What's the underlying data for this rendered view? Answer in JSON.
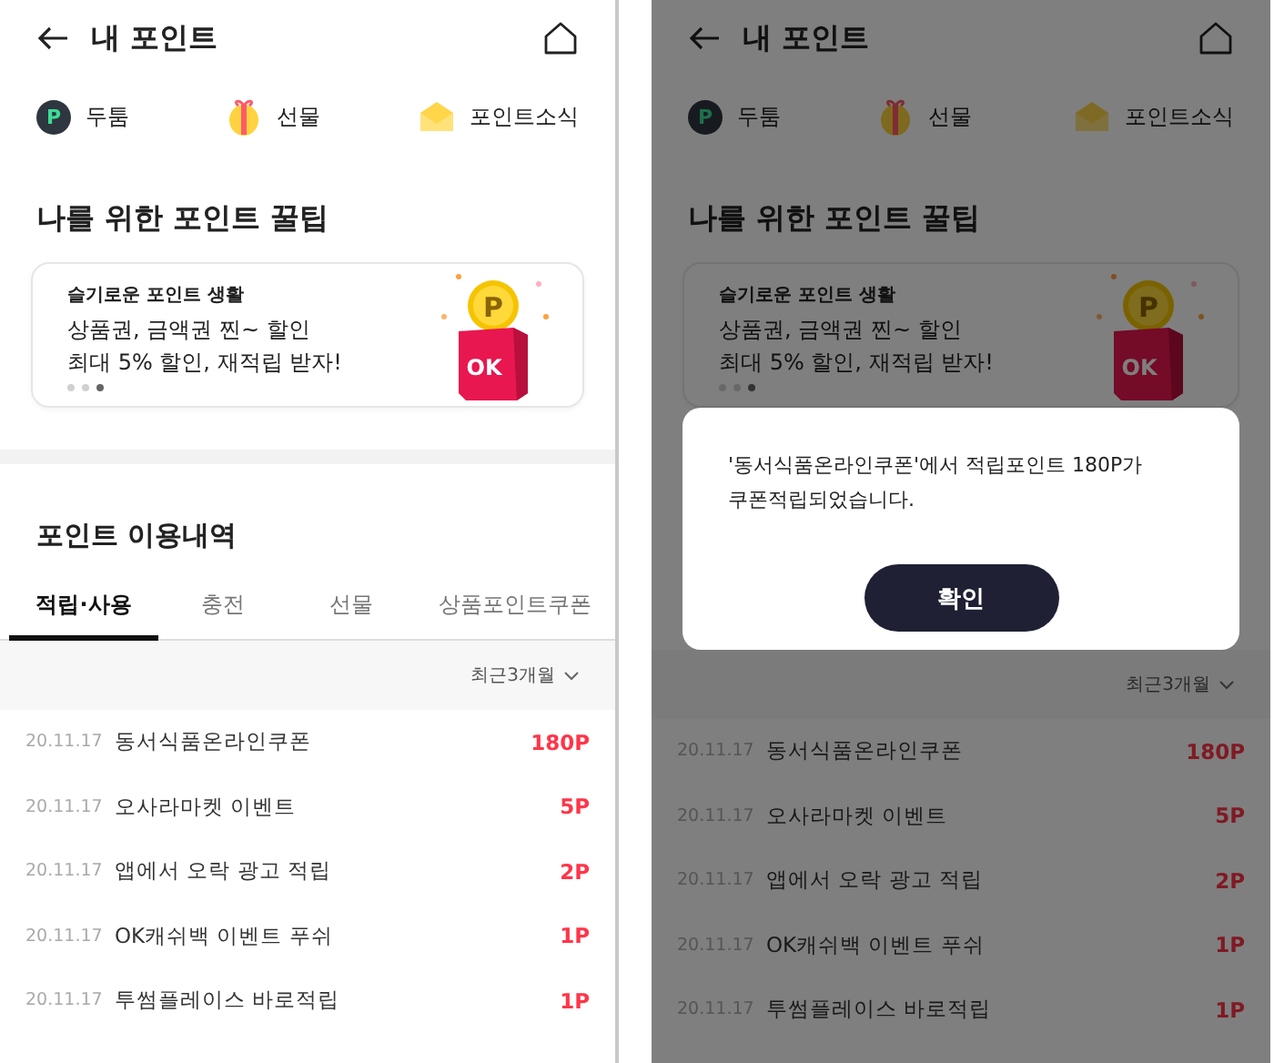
{
  "screens": [
    {
      "dimmed": false,
      "header": {
        "title": "내 포인트"
      },
      "shortcuts": [
        {
          "kind": "p-coin",
          "icon_text": "P",
          "label": "두툼"
        },
        {
          "kind": "gift",
          "label": "선물"
        },
        {
          "kind": "envelope",
          "label": "포인트소식"
        }
      ],
      "tips": {
        "title": "나를 위한 포인트 꿀팁",
        "subtitle": "슬기로운 포인트 생활",
        "lines": [
          "상품권, 금액권 찐~ 할인",
          "최대 5% 할인, 재적립 받자!"
        ],
        "coin_text": "P",
        "box_text": "OK",
        "slides": [
          {
            "selected": false
          },
          {
            "selected": false
          },
          {
            "selected": true
          }
        ]
      },
      "history": {
        "title": "포인트 이용내역",
        "tabs": [
          {
            "label": "적립·사용",
            "selected": true
          },
          {
            "label": "충전",
            "selected": false
          },
          {
            "label": "선물",
            "selected": false
          },
          {
            "label": "상품포인트쿠폰",
            "selected": false
          }
        ]
      },
      "filter": "최근3개월",
      "rows": [
        {
          "date": "20.11.17",
          "title": "동서식품온라인쿠폰",
          "points": "180P"
        },
        {
          "date": "20.11.17",
          "title": "오사라마켓 이벤트",
          "points": "5P"
        },
        {
          "date": "20.11.17",
          "title": "앱에서 오락 광고 적립",
          "points": "2P"
        },
        {
          "date": "20.11.17",
          "title": "OK캐쉬백 이벤트 푸쉬",
          "points": "1P"
        },
        {
          "date": "20.11.17",
          "title": "투썸플레이스 바로적립",
          "points": "1P"
        }
      ]
    },
    {
      "dimmed": true,
      "header": {
        "title": "내 포인트"
      },
      "shortcuts": [
        {
          "kind": "p-coin",
          "icon_text": "P",
          "label": "두툼"
        },
        {
          "kind": "gift",
          "label": "선물"
        },
        {
          "kind": "envelope",
          "label": "포인트소식"
        }
      ],
      "tips": {
        "title": "나를 위한 포인트 꿀팁",
        "subtitle": "슬기로운 포인트 생활",
        "lines": [
          "상품권, 금액권 찐~ 할인",
          "최대 5% 할인, 재적립 받자!"
        ],
        "coin_text": "P",
        "box_text": "OK",
        "slides": [
          {
            "selected": false
          },
          {
            "selected": false
          },
          {
            "selected": true
          }
        ]
      },
      "dialog": {
        "message_lines": [
          "'동서식품온라인쿠폰'에서 적립포인트 180P가",
          "쿠폰적립되었습니다."
        ],
        "button": "확인"
      },
      "filter": "최근3개월",
      "rows": [
        {
          "date": "20.11.17",
          "title": "동서식품온라인쿠폰",
          "points": "180P"
        },
        {
          "date": "20.11.17",
          "title": "오사라마켓 이벤트",
          "points": "5P"
        },
        {
          "date": "20.11.17",
          "title": "앱에서 오락 광고 적립",
          "points": "2P"
        },
        {
          "date": "20.11.17",
          "title": "OK캐쉬백 이벤트 푸쉬",
          "points": "1P"
        },
        {
          "date": "20.11.17",
          "title": "투썸플레이스 바로적립",
          "points": "1P"
        }
      ]
    }
  ]
}
